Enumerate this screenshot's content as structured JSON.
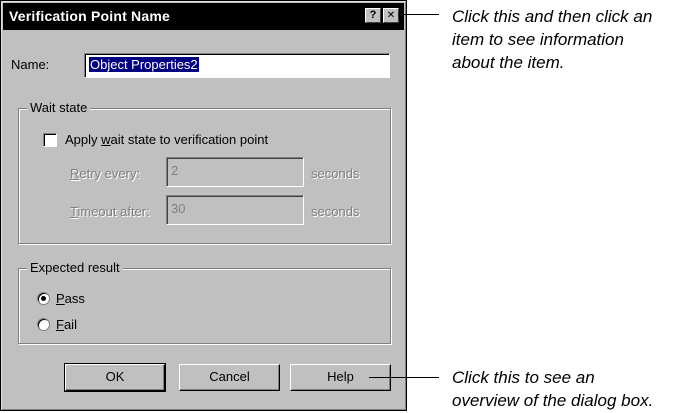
{
  "dialog": {
    "title": "Verification Point Name",
    "help_glyph": "?",
    "close_glyph": "✕",
    "name_label": "Name:",
    "name_value": "Object Properties2",
    "wait_state": {
      "group_label": "Wait state",
      "checkbox_label_pre": "Apply ",
      "checkbox_label_accel": "w",
      "checkbox_label_post": "ait state to verification point",
      "checkbox_checked": false,
      "retry_accel": "R",
      "retry_label_rest": "etry every:",
      "retry_value": "2",
      "retry_unit": "seconds",
      "timeout_accel": "T",
      "timeout_label_rest": "imeout after:",
      "timeout_value": "30",
      "timeout_unit": "seconds"
    },
    "expected": {
      "group_label": "Expected result",
      "pass_accel": "P",
      "pass_rest": "ass",
      "fail_accel": "F",
      "fail_rest": "ail",
      "selected": "Pass"
    },
    "buttons": {
      "ok": "OK",
      "cancel": "Cancel",
      "help": "Help"
    }
  },
  "callouts": {
    "help_icon": [
      "Click this and then click an",
      "item to see information",
      "about the item."
    ],
    "help_button": [
      "Click this to see an",
      "overview of the dialog box."
    ]
  }
}
